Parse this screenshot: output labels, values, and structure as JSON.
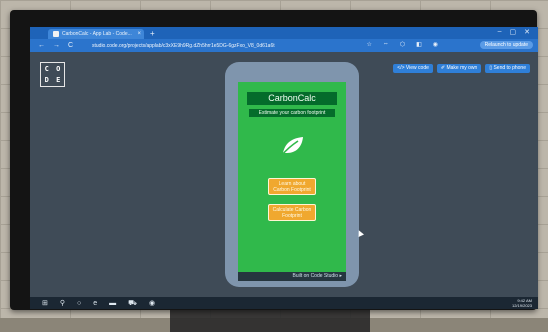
{
  "browser": {
    "tab_title": "CarbonCalc - App Lab - Code...",
    "tab_close": "×",
    "new_tab": "+",
    "window_controls": [
      "–",
      "▢",
      "✕"
    ],
    "nav": [
      "←",
      "→",
      "C"
    ],
    "url": "studio.code.org/projects/applab/c3xXE9h9Rg.dZh5hrr1e5DG-6gzFxo_V8_0d61a6t",
    "relaunch_label": "Relaunch to update"
  },
  "codeorg": {
    "logo_letters": [
      "C",
      "O",
      "D",
      "E"
    ],
    "actions": [
      "</> View code",
      "✐ Make my own",
      "▯ Send to phone"
    ]
  },
  "app": {
    "title": "CarbonCalc",
    "subtitle": "Estimate your carbon footprint",
    "button1": "Learn about Carbon Footprint",
    "button2": "Calculate Carbon Footprint",
    "footer": "Built on Code Studio ▸"
  },
  "taskbar": {
    "icons": [
      "⊞",
      "⚲",
      "○",
      "e",
      "▬",
      "⛟",
      "◉"
    ],
    "time": "9:42 AM",
    "date": "12/19/2023"
  },
  "colors": {
    "app_bg": "#30b94b",
    "title_bg": "#046b2b",
    "button_bg": "#f0a82f",
    "chrome_blue": "#2b74cc"
  }
}
